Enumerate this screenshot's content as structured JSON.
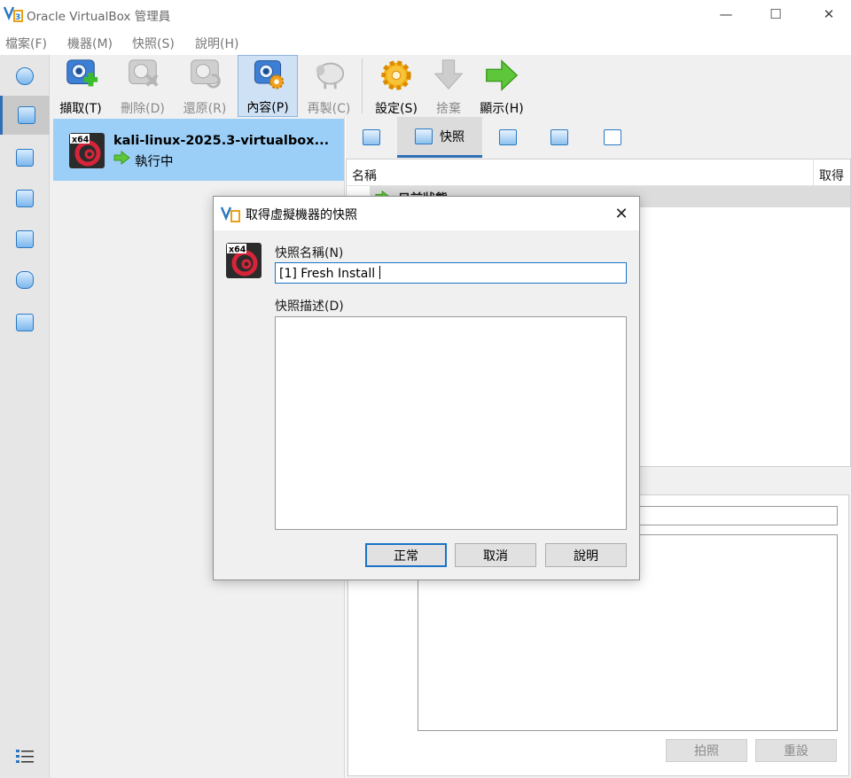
{
  "window": {
    "title": "Oracle VirtualBox 管理員",
    "controls": {
      "minimize": "—",
      "maximize": "☐",
      "close": "✕"
    }
  },
  "menu": {
    "items": [
      "檔案(F)",
      "機器(M)",
      "快照(S)",
      "說明(H)"
    ]
  },
  "toolbar": {
    "take": "擷取(T)",
    "delete": "刪除(D)",
    "restore": "還原(R)",
    "properties": "內容(P)",
    "clone": "再製(C)",
    "settings": "設定(S)",
    "discard": "捨棄",
    "show": "顯示(H)"
  },
  "vm": {
    "name": "kali-linux-2025.3-virtualbox...",
    "state": "執行中",
    "os_badge": "x64"
  },
  "detail_tabs": {
    "snapshots": "快照"
  },
  "snapshot_table": {
    "col_name": "名稱",
    "col_taken": "取得",
    "current_state": "目前狀態"
  },
  "detail_buttons": {
    "take": "拍照",
    "reset": "重設"
  },
  "dialog": {
    "title": "取得虛擬機器的快照",
    "close": "✕",
    "os_badge": "x64",
    "name_label": "快照名稱(N)",
    "name_value": "[1] Fresh Install",
    "desc_label": "快照描述(D)",
    "ok": "正常",
    "cancel": "取消",
    "help": "說明"
  },
  "colors": {
    "selection": "#9ccff7",
    "accent": "#1a73c6",
    "running": "#4caf50"
  }
}
